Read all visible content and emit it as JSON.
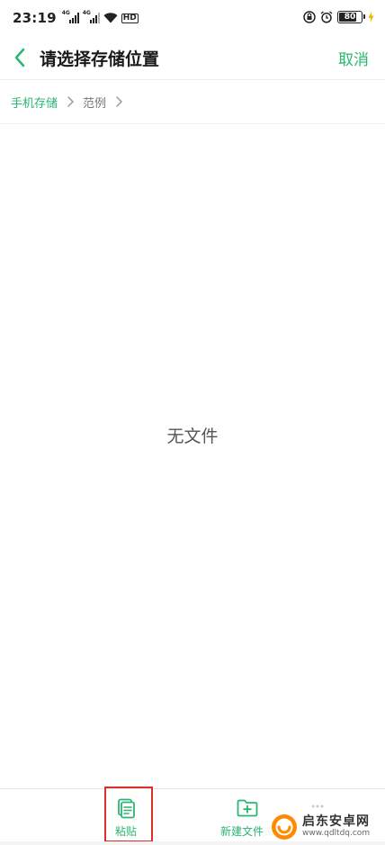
{
  "status_bar": {
    "time": "23:19",
    "signal_1_tag": "4G",
    "signal_2_tag": "4G",
    "hd_badge": "HD",
    "battery_level": "80",
    "battery_fraction": 0.8
  },
  "header": {
    "title": "请选择存储位置",
    "cancel_label": "取消"
  },
  "breadcrumb": {
    "items": [
      "手机存储",
      "范例"
    ]
  },
  "empty_state": {
    "text": "无文件"
  },
  "bottom_bar": {
    "paste_label": "粘贴",
    "new_folder_label": "新建文件夹"
  },
  "watermark": {
    "name": "启东安卓网",
    "url": "www.qdltdq.com"
  },
  "colors": {
    "accent": "#2bb673",
    "highlight": "#d9302c"
  },
  "icons": {
    "back": "chevron-left-icon",
    "crumb_separator": "chevron-right-icon",
    "paste": "clipboard-icon",
    "new_folder": "folder-plus-icon",
    "more": "more-icon"
  }
}
